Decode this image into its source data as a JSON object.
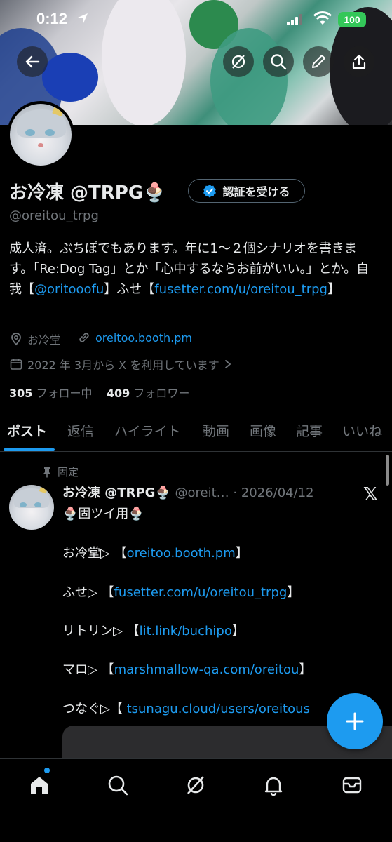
{
  "status_bar": {
    "time": "0:12",
    "battery": "100"
  },
  "colors": {
    "accent": "#1d9bf0",
    "background": "#000000",
    "text": "#e7e9ea",
    "muted": "#71767b",
    "battery": "#34c759"
  },
  "header_icons": [
    "back-arrow-icon",
    "grok-icon",
    "search-icon",
    "edit-icon",
    "share-icon"
  ],
  "profile": {
    "display_name": "お冷凍 @TRPG🍨",
    "verify_button": "認証を受ける",
    "handle": "@oreitou_trpg",
    "bio": {
      "text_1": "成人済。ぶちぽでもあります。年に1〜２個シナリオを書きます。「Re:Dog Tag」とか「心中するならお前がいい。」とか。自我【",
      "link_1": "@oritooofu",
      "text_2": "】ふせ【",
      "link_2": "fusetter.com/u/oreitou_trpg",
      "text_3": "】"
    },
    "location": "お冷堂",
    "website": "oreitoo.booth.pm",
    "joined": "2022 年 3月から X を利用しています",
    "following_count": "305",
    "following_label": "フォロー中",
    "followers_count": "409",
    "followers_label": "フォロワー"
  },
  "tabs": [
    {
      "label": "ポスト",
      "active": true
    },
    {
      "label": "返信"
    },
    {
      "label": "ハイライト"
    },
    {
      "label": "動画"
    },
    {
      "label": "画像"
    },
    {
      "label": "記事"
    },
    {
      "label": "いいね"
    }
  ],
  "pinned_post": {
    "pinned_label": "固定",
    "author": "お冷凍 @TRPG🍨",
    "handle_date": "@oreit… · 2026/04/12",
    "title": "🍨固ツイ用🍨",
    "lines": [
      {
        "prefix": "お冷堂▷ 【",
        "link": "oreitoo.booth.pm",
        "suffix": "】"
      },
      {
        "prefix": "ふせ▷ 【",
        "link": "fusetter.com/u/oreitou_trpg",
        "suffix": "】"
      },
      {
        "prefix": "リトリン▷ 【",
        "link": "lit.link/buchipo",
        "suffix": "】"
      },
      {
        "prefix": "マロ▷ 【",
        "link": "marshmallow-qa.com/oreitou",
        "suffix": "】"
      },
      {
        "prefix": "つなぐ▷【 ",
        "link": "tsunagu.cloud/users/oreitous",
        "suffix": ""
      }
    ]
  },
  "bottom_nav": [
    "home-icon",
    "search-icon",
    "grok-icon",
    "notifications-icon",
    "messages-icon"
  ]
}
